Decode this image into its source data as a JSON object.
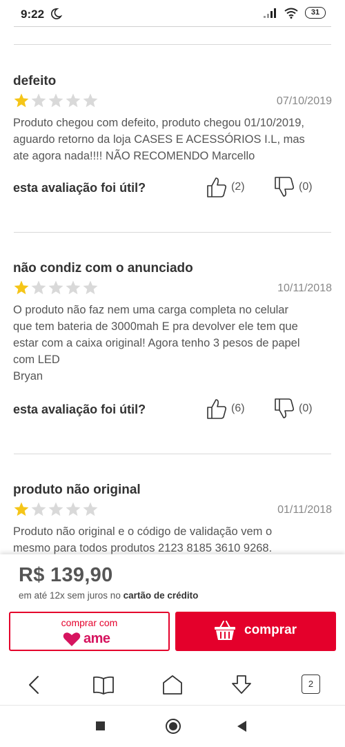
{
  "status_bar": {
    "time": "9:22",
    "battery": "31"
  },
  "reviews": [
    {
      "title": "defeito",
      "rating": 1,
      "max_rating": 5,
      "date": "07/10/2019",
      "body_lines": [
        "Produto chegou com defeito, produto chegou 01/10/2019,",
        "aguardo retorno da loja CASES E ACESSÓRIOS I.L, mas",
        "ate agora nada!!!! NÃO RECOMENDO Marcello"
      ],
      "helpful_label": "esta avaliação foi útil?",
      "likes": "(2)",
      "dislikes": "(0)"
    },
    {
      "title": "não condiz com o anunciado",
      "rating": 1,
      "max_rating": 5,
      "date": "10/11/2018",
      "body_lines": [
        "O produto não faz nem uma carga completa no celular",
        "que tem bateria de 3000mah E pra devolver ele tem que",
        "estar com a caixa original! Agora tenho 3 pesos de papel",
        "com LED",
        "Bryan"
      ],
      "helpful_label": "esta avaliação foi útil?",
      "likes": "(6)",
      "dislikes": "(0)"
    },
    {
      "title": "produto não original",
      "rating": 1,
      "max_rating": 5,
      "date": "01/11/2018",
      "body_lines": [
        "Produto não original e o código de validação vem o",
        "mesmo para todos produtos 2123 8185 3610 9268."
      ]
    }
  ],
  "purchase": {
    "price": "R$ 139,90",
    "installments_prefix": "em até 12x sem juros no ",
    "installments_bold": "cartão de crédito",
    "ame_button_label": "comprar com",
    "ame_logo_text": "ame",
    "buy_button_label": "comprar"
  },
  "browser": {
    "tab_count": "2"
  },
  "colors": {
    "accent_red": "#e4002b",
    "star_filled": "#f5c518",
    "star_empty": "#d9d9d9",
    "ame_pink": "#d6145f"
  }
}
